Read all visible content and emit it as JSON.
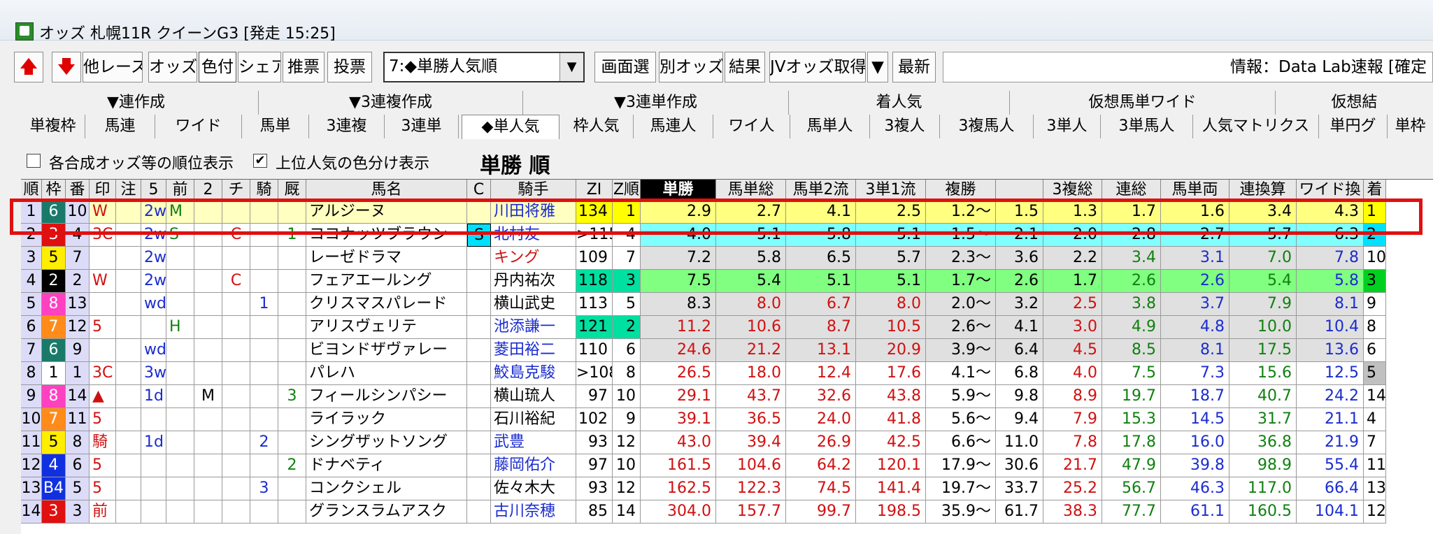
{
  "window": {
    "title": "オッズ 札幌11R クイーンG3 [発走 15:25]"
  },
  "toolbar": {
    "up_label": "🡅",
    "down_label": "🡇",
    "buttons": [
      "他レース",
      "オッズ",
      "色付",
      "シェア",
      "推票",
      "投票"
    ],
    "combo_value": "7:◆単勝人気順",
    "buttons2": [
      "画面選",
      "別オッズ",
      "結果",
      "JVオッズ取得",
      "最新"
    ],
    "jv_dropdown": "▼",
    "info": "情報：Data Lab速報 [確定"
  },
  "tabs_row1": [
    "▼連作成",
    "▼3連複作成",
    "▼3連単作成",
    "着人気",
    "仮想馬単ワイド",
    "仮想結"
  ],
  "tabs_row2": [
    "単複枠",
    "馬連",
    "ワイド",
    "馬単",
    "3連複",
    "3連単",
    "◆単人気",
    "枠人気",
    "馬連人",
    "ワイ人",
    "馬単人",
    "3複人",
    "3複馬人",
    "3単人",
    "3単馬人",
    "人気マトリクス",
    "単円グ",
    "単枠"
  ],
  "options": {
    "opt1": {
      "checked": "",
      "label": "各合成オッズ等の順位表示"
    },
    "opt2": {
      "checked": "✔",
      "label": "上位人気の色分け表示"
    },
    "heading": "単勝 順"
  },
  "headers": [
    "順",
    "枠",
    "番",
    "印",
    "注",
    "5",
    "前",
    "2",
    "チ",
    "騎",
    "厩",
    "馬名",
    "C",
    "騎手",
    "ZI",
    "Z順",
    "単勝",
    "馬単総",
    "馬単2流",
    "3単1流",
    "複勝",
    "",
    "3複総",
    "連総",
    "馬単両",
    "連換算",
    "ワイド換",
    "着"
  ],
  "rows": [
    {
      "rank": "1",
      "waku": "6",
      "num": "10",
      "mark": "W",
      "chu": "",
      "f5": "2w",
      "mae": "M",
      "f2": "",
      "chi": "",
      "ki": "",
      "kyu": "",
      "name": "アルジーヌ",
      "c": "",
      "jockey": "川田将雅",
      "zi": "134",
      "zr": "1",
      "tan": "2.9",
      "ut": "2.7",
      "u2": "4.1",
      "s1": "2.5",
      "fk1": "1.2～",
      "fk2": "1.5",
      "f3": "1.3",
      "rs": "1.7",
      "ur": "1.6",
      "rk": "3.4",
      "wk": "4.3",
      "chaku": "1"
    },
    {
      "rank": "2",
      "waku": "3",
      "num": "4",
      "mark": "3C",
      "chu": "",
      "f5": "2w",
      "mae": "S",
      "f2": "",
      "chi": "C",
      "ki": "",
      "kyu": "1",
      "name": "ココナッツブラウン",
      "c": "S",
      "jockey": "北村友一",
      "zi": ">115",
      "zr": "4",
      "tan": "4.0",
      "ut": "5.1",
      "u2": "5.8",
      "s1": "5.1",
      "fk1": "1.5～",
      "fk2": "2.1",
      "f3": "2.0",
      "rs": "2.8",
      "ur": "2.7",
      "rk": "5.7",
      "wk": "6.3",
      "chaku": "2"
    },
    {
      "rank": "3",
      "waku": "5",
      "num": "7",
      "mark": "",
      "chu": "",
      "f5": "2w",
      "mae": "",
      "f2": "",
      "chi": "",
      "ki": "",
      "kyu": "",
      "name": "レーゼドラマ",
      "c": "",
      "jockey": "キング",
      "zi": "109",
      "zr": "7",
      "tan": "7.2",
      "ut": "5.8",
      "u2": "6.5",
      "s1": "5.7",
      "fk1": "2.3～",
      "fk2": "3.6",
      "f3": "2.2",
      "rs": "3.4",
      "ur": "3.1",
      "rk": "7.0",
      "wk": "7.8",
      "chaku": "10"
    },
    {
      "rank": "4",
      "waku": "2",
      "num": "2",
      "mark": "W",
      "chu": "",
      "f5": "2w",
      "mae": "",
      "f2": "",
      "chi": "C",
      "ki": "",
      "kyu": "",
      "name": "フェアエールング",
      "c": "",
      "jockey": "丹内祐次",
      "zi": "118",
      "zr": "3",
      "tan": "7.5",
      "ut": "5.4",
      "u2": "5.1",
      "s1": "5.1",
      "fk1": "1.7～",
      "fk2": "2.6",
      "f3": "1.7",
      "rs": "2.6",
      "ur": "2.6",
      "rk": "5.4",
      "wk": "5.8",
      "chaku": "3"
    },
    {
      "rank": "5",
      "waku": "8",
      "num": "13",
      "mark": "",
      "chu": "",
      "f5": "wd",
      "mae": "",
      "f2": "",
      "chi": "",
      "ki": "1",
      "kyu": "",
      "name": "クリスマスパレード",
      "c": "",
      "jockey": "横山武史",
      "zi": "113",
      "zr": "5",
      "tan": "8.3",
      "ut": "8.0",
      "u2": "6.7",
      "s1": "8.0",
      "fk1": "2.0～",
      "fk2": "3.2",
      "f3": "2.5",
      "rs": "3.8",
      "ur": "3.7",
      "rk": "7.9",
      "wk": "8.1",
      "chaku": "9"
    },
    {
      "rank": "6",
      "waku": "7",
      "num": "12",
      "mark": "5",
      "chu": "",
      "f5": "",
      "mae": "H",
      "f2": "",
      "chi": "",
      "ki": "",
      "kyu": "",
      "name": "アリスヴェリテ",
      "c": "",
      "jockey": "池添謙一",
      "zi": "121",
      "zr": "2",
      "tan": "11.2",
      "ut": "10.6",
      "u2": "8.7",
      "s1": "10.5",
      "fk1": "2.6～",
      "fk2": "4.1",
      "f3": "3.0",
      "rs": "4.9",
      "ur": "4.8",
      "rk": "10.0",
      "wk": "10.4",
      "chaku": "8"
    },
    {
      "rank": "7",
      "waku": "6",
      "num": "9",
      "mark": "",
      "chu": "",
      "f5": "wd",
      "mae": "",
      "f2": "",
      "chi": "",
      "ki": "",
      "kyu": "",
      "name": "ビヨンドザヴァレー",
      "c": "",
      "jockey": "菱田裕二",
      "zi": "110",
      "zr": "6",
      "tan": "24.6",
      "ut": "21.2",
      "u2": "13.1",
      "s1": "20.9",
      "fk1": "3.9～",
      "fk2": "6.4",
      "f3": "4.5",
      "rs": "8.5",
      "ur": "8.1",
      "rk": "17.5",
      "wk": "13.6",
      "chaku": "6"
    },
    {
      "rank": "8",
      "waku": "1",
      "num": "1",
      "mark": "3C",
      "chu": "",
      "f5": "3w",
      "mae": "",
      "f2": "",
      "chi": "",
      "ki": "",
      "kyu": "",
      "name": "パレハ",
      "c": "",
      "jockey": "鮫島克駿",
      "zi": ">108",
      "zr": "8",
      "tan": "26.5",
      "ut": "18.0",
      "u2": "12.4",
      "s1": "17.6",
      "fk1": "4.1～",
      "fk2": "6.8",
      "f3": "4.0",
      "rs": "7.5",
      "ur": "7.3",
      "rk": "15.6",
      "wk": "12.5",
      "chaku": "5"
    },
    {
      "rank": "9",
      "waku": "8",
      "num": "14",
      "mark": "▲",
      "chu": "",
      "f5": "1d",
      "mae": "",
      "f2": "M",
      "chi": "",
      "ki": "",
      "kyu": "3",
      "name": "フィールシンパシー",
      "c": "",
      "jockey": "横山琉人",
      "zi": "97",
      "zr": "10",
      "tan": "29.1",
      "ut": "43.7",
      "u2": "32.6",
      "s1": "43.8",
      "fk1": "5.9～",
      "fk2": "9.8",
      "f3": "8.9",
      "rs": "19.7",
      "ur": "18.7",
      "rk": "40.7",
      "wk": "24.2",
      "chaku": "14"
    },
    {
      "rank": "10",
      "waku": "7",
      "num": "11",
      "mark": "5",
      "chu": "",
      "f5": "",
      "mae": "",
      "f2": "",
      "chi": "",
      "ki": "",
      "kyu": "",
      "name": "ライラック",
      "c": "",
      "jockey": "石川裕紀",
      "zi": "102",
      "zr": "9",
      "tan": "39.1",
      "ut": "36.5",
      "u2": "24.0",
      "s1": "41.8",
      "fk1": "5.6～",
      "fk2": "9.4",
      "f3": "7.9",
      "rs": "15.3",
      "ur": "14.5",
      "rk": "31.7",
      "wk": "21.1",
      "chaku": "4"
    },
    {
      "rank": "11",
      "waku": "5",
      "num": "8",
      "mark": "騎",
      "chu": "",
      "f5": "1d",
      "mae": "",
      "f2": "",
      "chi": "",
      "ki": "2",
      "kyu": "",
      "name": "シングザットソング",
      "c": "",
      "jockey": "武豊",
      "zi": "93",
      "zr": "12",
      "tan": "43.0",
      "ut": "39.4",
      "u2": "26.9",
      "s1": "42.5",
      "fk1": "6.6～",
      "fk2": "11.0",
      "f3": "7.8",
      "rs": "17.8",
      "ur": "16.0",
      "rk": "36.8",
      "wk": "21.9",
      "chaku": "7"
    },
    {
      "rank": "12",
      "waku": "4",
      "num": "6",
      "mark": "5",
      "chu": "",
      "f5": "",
      "mae": "",
      "f2": "",
      "chi": "",
      "ki": "",
      "kyu": "2",
      "name": "ドナベティ",
      "c": "",
      "jockey": "藤岡佑介",
      "zi": "97",
      "zr": "10",
      "tan": "161.5",
      "ut": "104.6",
      "u2": "64.2",
      "s1": "120.1",
      "fk1": "17.9～",
      "fk2": "30.6",
      "f3": "21.7",
      "rs": "47.9",
      "ur": "39.8",
      "rk": "98.9",
      "wk": "55.4",
      "chaku": "11"
    },
    {
      "rank": "13",
      "waku": "B4",
      "num": "5",
      "mark": "5",
      "chu": "",
      "f5": "",
      "mae": "",
      "f2": "",
      "chi": "",
      "ki": "3",
      "kyu": "",
      "name": "コンクシェル",
      "c": "",
      "jockey": "佐々木大",
      "zi": "93",
      "zr": "12",
      "tan": "162.5",
      "ut": "122.3",
      "u2": "74.5",
      "s1": "141.4",
      "fk1": "19.7～",
      "fk2": "33.7",
      "f3": "25.2",
      "rs": "56.7",
      "ur": "46.3",
      "rk": "117.0",
      "wk": "66.4",
      "chaku": "13"
    },
    {
      "rank": "14",
      "waku": "3",
      "num": "3",
      "mark": "前",
      "chu": "",
      "f5": "",
      "mae": "",
      "f2": "",
      "chi": "",
      "ki": "",
      "kyu": "",
      "name": "グランスラムアスク",
      "c": "",
      "jockey": "古川奈穂",
      "zi": "85",
      "zr": "14",
      "tan": "304.0",
      "ut": "157.7",
      "u2": "99.7",
      "s1": "198.5",
      "fk1": "35.9～",
      "fk2": "61.7",
      "f3": "38.3",
      "rs": "77.7",
      "ur": "61.1",
      "rk": "160.5",
      "wk": "104.1",
      "chaku": "12"
    }
  ],
  "colors": {
    "accent_red": "#e01010",
    "jockey_blue": "#1a2ccf",
    "selected_tab": "#ffffff"
  }
}
